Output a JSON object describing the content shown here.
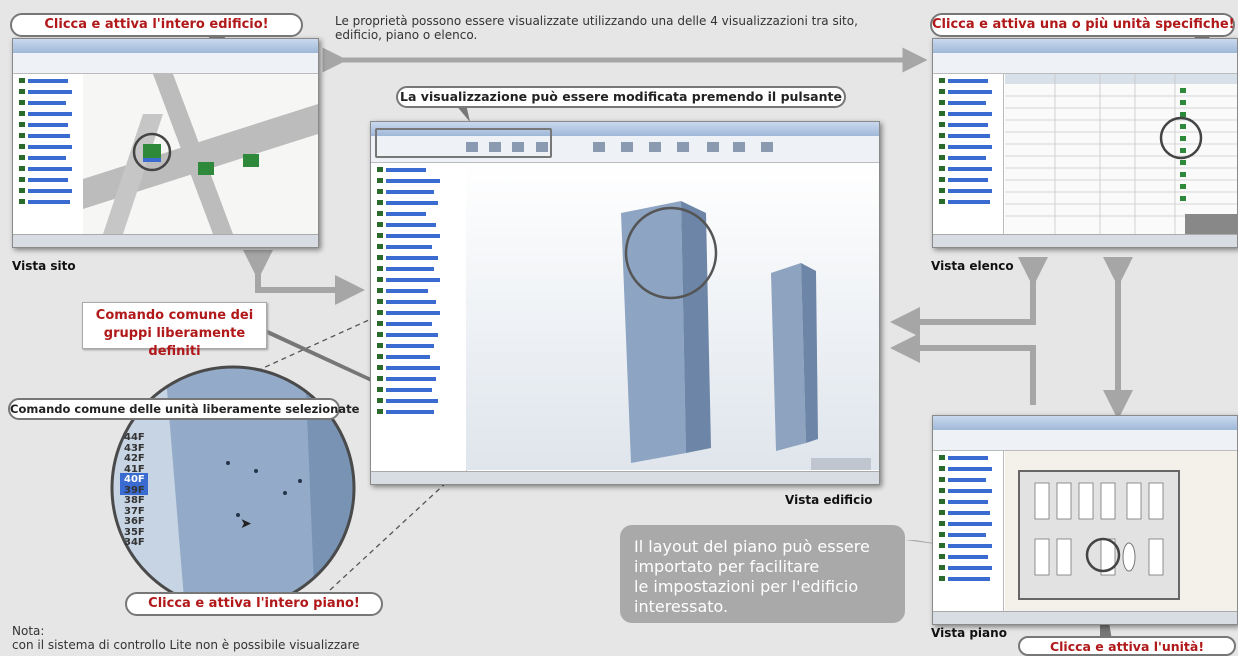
{
  "labels": {
    "top_left": "Clicca e attiva l'intero edificio!",
    "top_right": "Clicca e attiva una o più unità specifiche!",
    "center_toolbar": "La visualizzazione può essere modificata premendo il pulsante",
    "common_groups_l1": "Comando comune dei",
    "common_groups_l2": "gruppi liberamente definiti",
    "common_units": "Comando comune delle unità liberamente selezionate",
    "floor": "Clicca e attiva l'intero piano!",
    "unit": "Clicca e attiva l'unità!"
  },
  "captions": {
    "site": "Vista sito",
    "list": "Vista elenco",
    "building": "Vista edificio",
    "floor": "Vista piano"
  },
  "intro_text": {
    "line1": "Le proprietà possono essere visualizzate utilizzando una delle 4 visualizzazioni tra sito,",
    "line2": "edificio, piano o elenco."
  },
  "layout_note": {
    "line1": "Il layout del piano può essere",
    "line2": "importato per facilitare",
    "line3": "le impostazioni per l'edificio",
    "line4": "interessato."
  },
  "footnote": {
    "title": "Nota:",
    "line1": "con il sistema di controllo Lite non è possibile visualizzare"
  },
  "floors": [
    "44F",
    "43F",
    "42F",
    "41F",
    "40F",
    "39F",
    "38F",
    "37F",
    "36F",
    "35F",
    "34F"
  ],
  "colors": {
    "accent": "#b01819",
    "arrow": "#a6a6a6",
    "background": "#e6e6e6",
    "selection": "#3a6bd0"
  }
}
